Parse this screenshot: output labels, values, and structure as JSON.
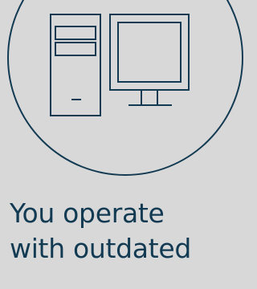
{
  "illustration": {
    "icon": "desktop-computer-icon",
    "stroke_color": "#123a52",
    "background_color": "#d8d8d8"
  },
  "caption": {
    "line1": "You operate",
    "line2": "with outdated"
  }
}
